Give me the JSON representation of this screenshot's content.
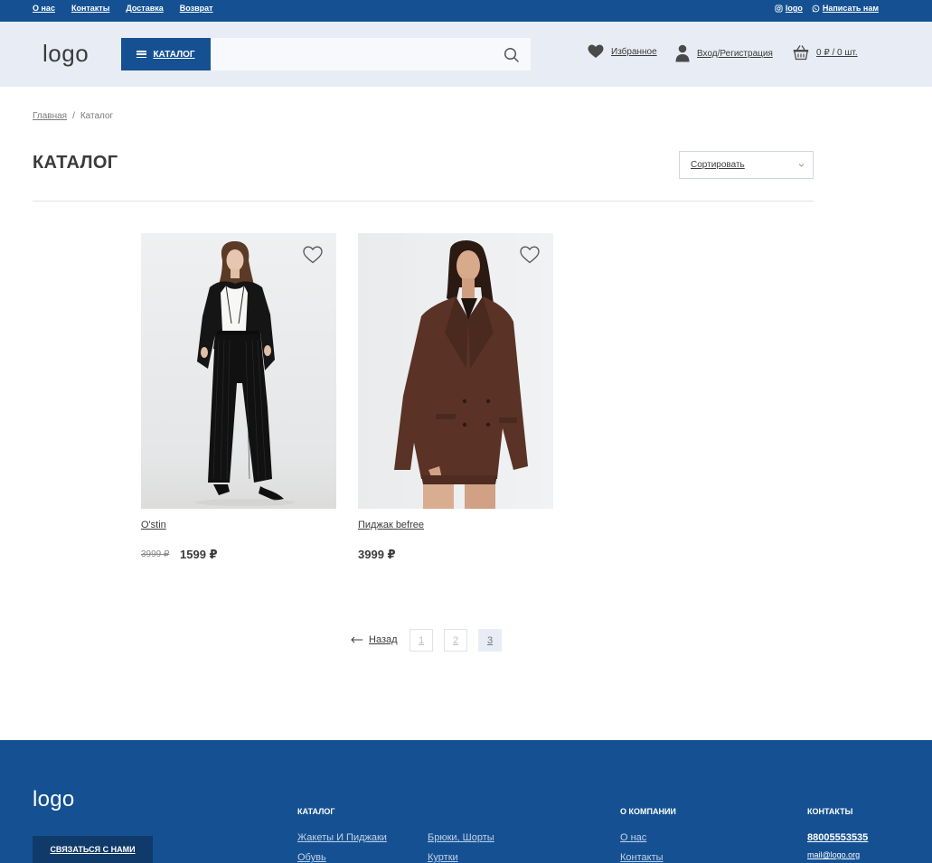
{
  "topbar": {
    "links": [
      "О нас",
      "Контакты",
      "Доставка",
      "Возврат"
    ],
    "instagram_label": "logo",
    "whatsapp_label": "Написать нам"
  },
  "header": {
    "logo": "logo",
    "catalog_label": "КАТАЛОГ",
    "search_placeholder": "",
    "favorites_label": "Избранное",
    "login_label": "Вход/Регистрация",
    "cart_label": "0 ₽ / 0 шт."
  },
  "breadcrumb": {
    "home": "Главная",
    "separator": "/",
    "current": "Каталог"
  },
  "page": {
    "title": "КАТАЛОГ",
    "sort_label": "Сортировать"
  },
  "products": [
    {
      "name": "O'stin",
      "old_price": "3999 ₽",
      "price": "1599 ₽"
    },
    {
      "name": "Пиджак befree",
      "old_price": "",
      "price": "3999 ₽"
    }
  ],
  "pagination": {
    "back_label": "Назад",
    "pages": [
      "1",
      "2",
      "3"
    ],
    "active_page": "3"
  },
  "footer": {
    "logo": "logo",
    "contact_button": "СВЯЗАТЬСЯ С НАМИ",
    "catalog_title": "КАТАЛОГ",
    "catalog_links": [
      "Жакеты И Пиджаки",
      "Брюки, Шорты",
      "Обувь",
      "Куртки"
    ],
    "company_title": "О КОМПАНИИ",
    "company_links": [
      "О нас",
      "Контакты"
    ],
    "contacts_title": "КОНТАКТЫ",
    "phone": "88005553535",
    "email": "mail@logo.org"
  },
  "colors": {
    "brand_blue": "#155192",
    "header_bg": "#e8edf5",
    "text": "#3b3b3b"
  }
}
